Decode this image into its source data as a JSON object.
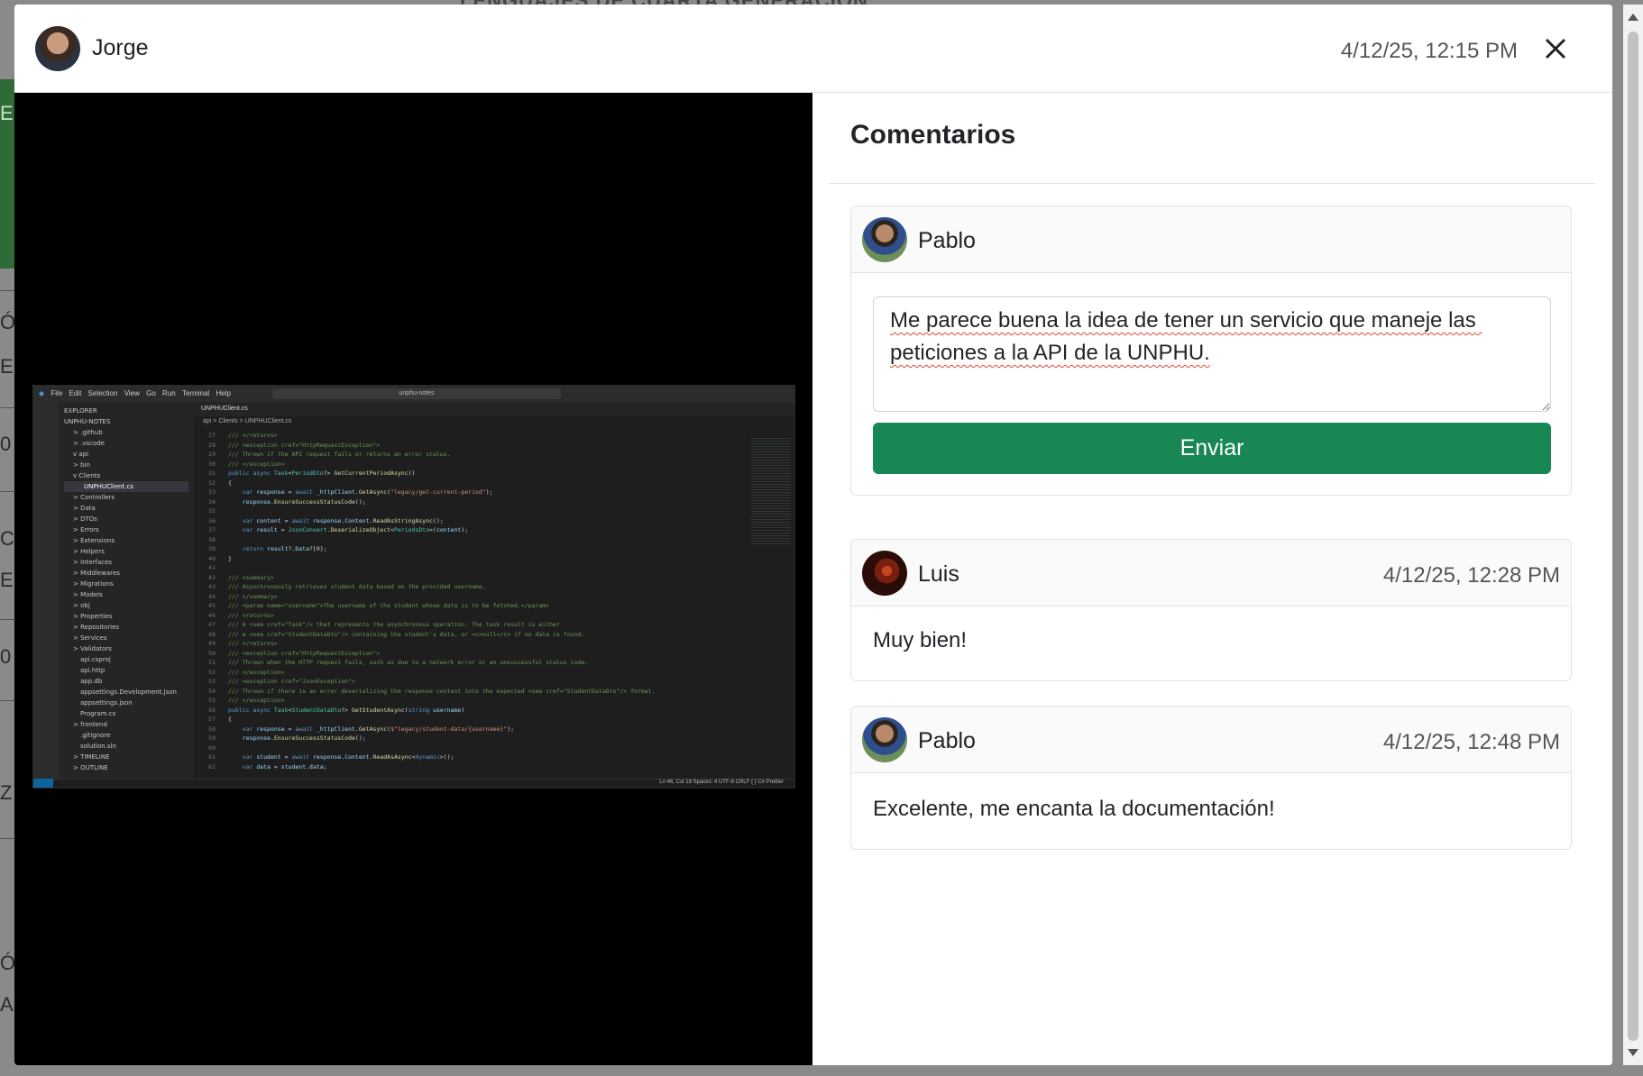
{
  "background": {
    "title_fragment": "LENGUAJES DE CUARTA GENERACIÓN",
    "fragments": [
      "EN",
      "ÓN",
      "E",
      "0",
      "C",
      "E",
      "0",
      "Z S",
      "ÓN",
      "A"
    ]
  },
  "modal": {
    "author": {
      "name": "Jorge"
    },
    "timestamp": "4/12/25, 12:15 PM",
    "close_icon": "close-icon"
  },
  "media": {
    "vscode": {
      "menu": [
        "File",
        "Edit",
        "Selection",
        "View",
        "Go",
        "Run",
        "Terminal",
        "Help"
      ],
      "search": "unphu-notes",
      "explorer_header": "EXPLORER",
      "explorer_items": [
        "UNPHU-NOTES",
        "> .github",
        "> .vscode",
        "v api",
        "> bin",
        "v Clients",
        "UNPHUClient.cs",
        "> Controllers",
        "> Data",
        "> DTOs",
        "> Errors",
        "> Extensions",
        "> Helpers",
        "> Interfaces",
        "> Middlewares",
        "> Migrations",
        "> Models",
        "> obj",
        "> Properties",
        "> Repositories",
        "> Services",
        "> Validators",
        "api.csproj",
        "api.http",
        "app.db",
        "appsettings.Development.json",
        "appsettings.json",
        "Program.cs",
        "> frontend",
        ".gitignore",
        "solution.sln",
        "> TIMELINE",
        "> OUTLINE"
      ],
      "tab": "UNPHUClient.cs",
      "breadcrumb": "api > Clients > UNPHUClient.cs",
      "status": "Ln 46, Col 18   Spaces: 4   UTF-8   CRLF   { } C#   Prettier"
    }
  },
  "comments": {
    "title": "Comentarios",
    "compose": {
      "author": "Pablo",
      "draft": "Me parece buena la idea de tener un servicio que maneje las peticiones a la API de la UNPHU.",
      "send_label": "Enviar"
    },
    "items": [
      {
        "author": "Luis",
        "time": "4/12/25, 12:28 PM",
        "text": "Muy bien!"
      },
      {
        "author": "Pablo",
        "time": "4/12/25, 12:48 PM",
        "text": "Excelente, me encanta la documentación!"
      }
    ]
  },
  "colors": {
    "send_button": "#198754",
    "editor_bg": "#1e1e1e"
  }
}
